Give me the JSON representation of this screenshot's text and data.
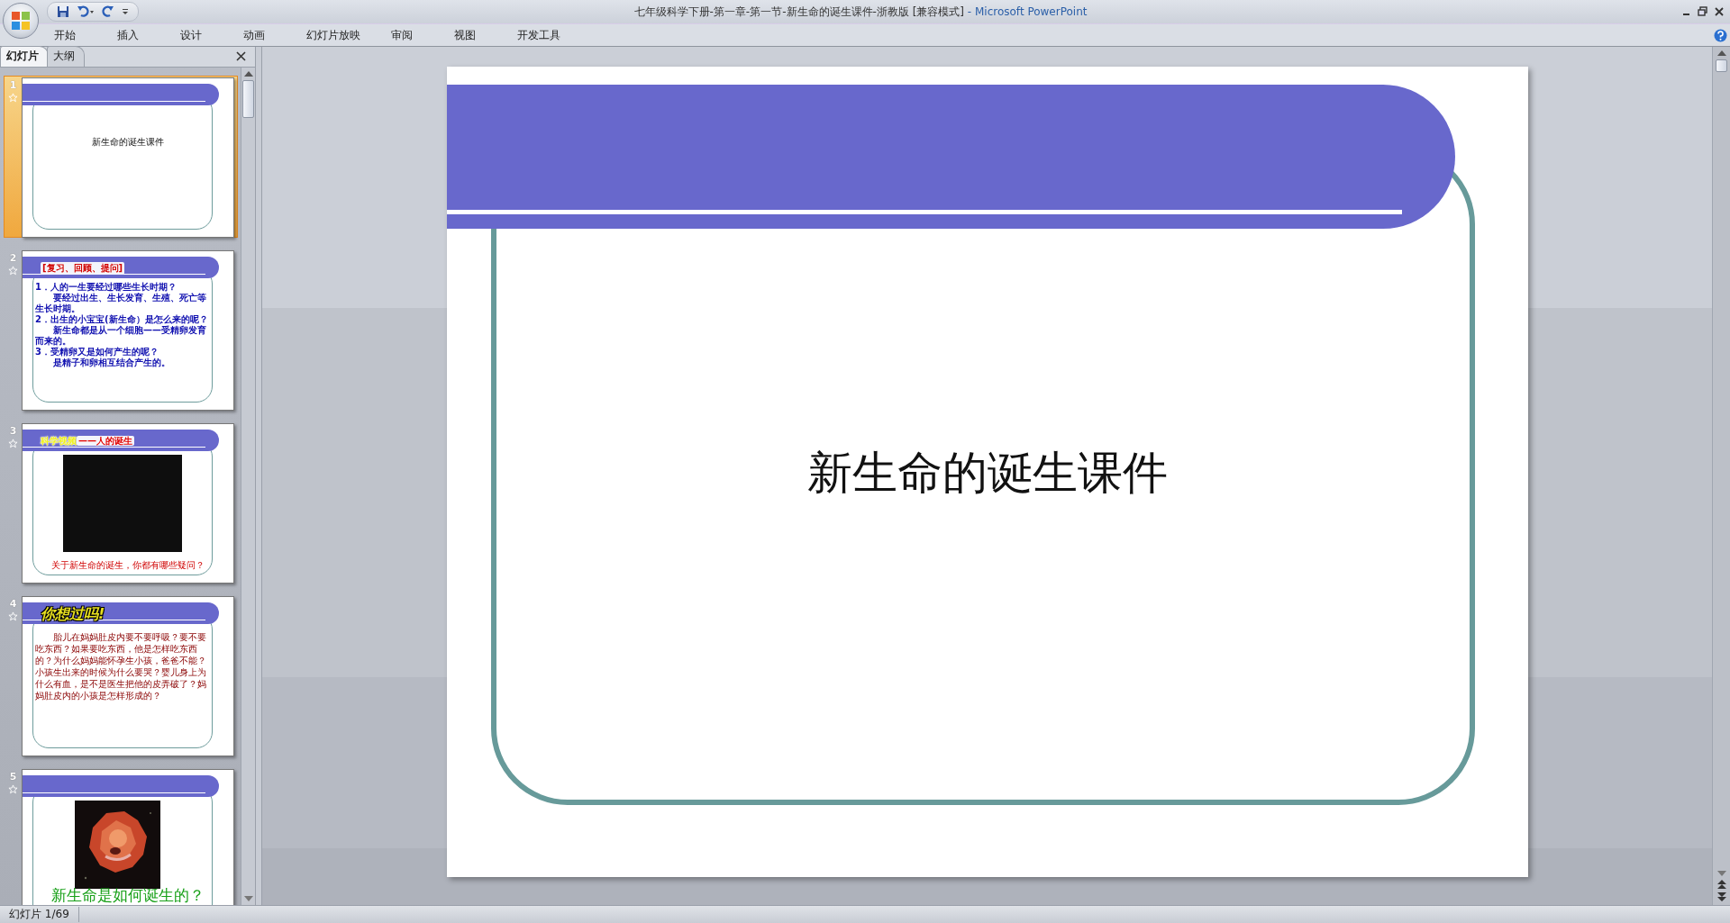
{
  "window": {
    "title": "七年级科学下册-第一章-第一节-新生命的诞生课件-浙教版 [兼容模式]",
    "app_name": "- Microsoft PowerPoint"
  },
  "ribbon_tabs": [
    {
      "label": "开始"
    },
    {
      "label": "插入"
    },
    {
      "label": "设计"
    },
    {
      "label": "动画"
    },
    {
      "label": "幻灯片放映"
    },
    {
      "label": "审阅"
    },
    {
      "label": "视图"
    },
    {
      "label": "开发工具"
    }
  ],
  "pane_tabs": [
    {
      "label": "幻灯片",
      "selected": true
    },
    {
      "label": "大纲",
      "selected": false
    }
  ],
  "slides": [
    {
      "number": "1",
      "selected": true,
      "kind": "title",
      "title": "新生命的诞生课件"
    },
    {
      "number": "2",
      "selected": false,
      "kind": "list",
      "heading": "[复习、回顾、提问]",
      "lines": [
        {
          "text": "1．人的一生要经过哪些生长时期？",
          "indent": false
        },
        {
          "text": "要经过出生、生长发育、生殖、死亡等生长时期。",
          "indent": true
        },
        {
          "text": "2．出生的小宝宝(新生命）是怎么来的呢？",
          "indent": false
        },
        {
          "text": "新生命都是从一个细胞——受精卵发育而来的。",
          "indent": true
        },
        {
          "text": "3．受精卵又是如何产生的呢？",
          "indent": false
        },
        {
          "text": "是精子和卵相互结合产生的。",
          "indent": true
        }
      ]
    },
    {
      "number": "3",
      "selected": false,
      "kind": "video",
      "title_parts": [
        {
          "text": "科学视频",
          "color": "#f0f020"
        },
        {
          "text": "——人的诞生",
          "color": "#e00000"
        }
      ],
      "caption": "关于新生命的诞生，你都有哪些疑问？"
    },
    {
      "number": "4",
      "selected": false,
      "kind": "paragraph",
      "heading": "你想过吗!",
      "text": "胎儿在妈妈肚皮内要不要呼吸？要不要吃东西？如果要吃东西，他是怎样吃东西的？为什么妈妈能怀孕生小孩，爸爸不能？小孩生出来的时候为什么要哭？婴儿身上为什么有血，是不是医生把他的皮弄破了？妈妈肚皮内的小孩是怎样形成的？"
    },
    {
      "number": "5",
      "selected": false,
      "caption": "新生命是如何诞生的？"
    }
  ],
  "main_slide": {
    "title": "新生命的诞生课件"
  },
  "status_bar": {
    "slide_counter": "幻灯片 1/69"
  }
}
